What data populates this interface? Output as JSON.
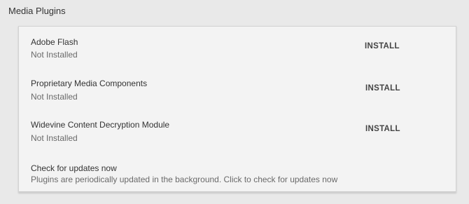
{
  "section": {
    "title": "Media Plugins"
  },
  "plugins": [
    {
      "name": "Adobe Flash",
      "status": "Not Installed",
      "action": "INSTALL"
    },
    {
      "name": "Proprietary Media Components",
      "status": "Not Installed",
      "action": "INSTALL"
    },
    {
      "name": "Widevine Content Decryption Module",
      "status": "Not Installed",
      "action": "INSTALL"
    }
  ],
  "updates": {
    "title": "Check for updates now",
    "description": "Plugins are periodically updated in the background. Click to check for updates now"
  }
}
